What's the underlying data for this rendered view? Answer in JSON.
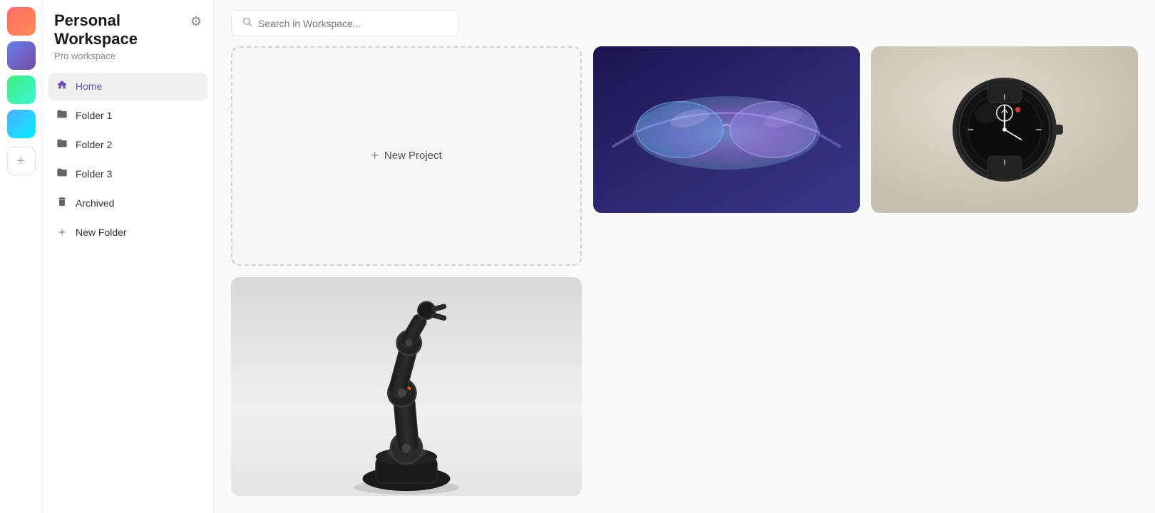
{
  "workspace": {
    "title": "Personal Workspace",
    "subtitle": "Pro workspace"
  },
  "search": {
    "placeholder": "Search in Workspace..."
  },
  "nav": {
    "items": [
      {
        "id": "home",
        "label": "Home",
        "icon": "🏠",
        "active": true
      },
      {
        "id": "folder1",
        "label": "Folder 1",
        "icon": "📁",
        "active": false
      },
      {
        "id": "folder2",
        "label": "Folder 2",
        "icon": "📁",
        "active": false
      },
      {
        "id": "folder3",
        "label": "Folder 3",
        "icon": "📁",
        "active": false
      },
      {
        "id": "archived",
        "label": "Archived",
        "icon": "🗑",
        "active": false
      },
      {
        "id": "new-folder",
        "label": "New Folder",
        "icon": "+",
        "active": false
      }
    ]
  },
  "projects": {
    "new_project_label": "New Project",
    "items": [
      {
        "id": "glasses",
        "type": "glasses",
        "alt": "AR Glasses project"
      },
      {
        "id": "watch",
        "type": "watch",
        "alt": "Smart Watch project"
      },
      {
        "id": "robot",
        "type": "robot",
        "alt": "Robot Arm project"
      }
    ]
  },
  "icons": {
    "settings": "⚙",
    "search": "🔍",
    "add": "+",
    "home": "⌂",
    "folder": "▤",
    "trash": "🗑"
  }
}
